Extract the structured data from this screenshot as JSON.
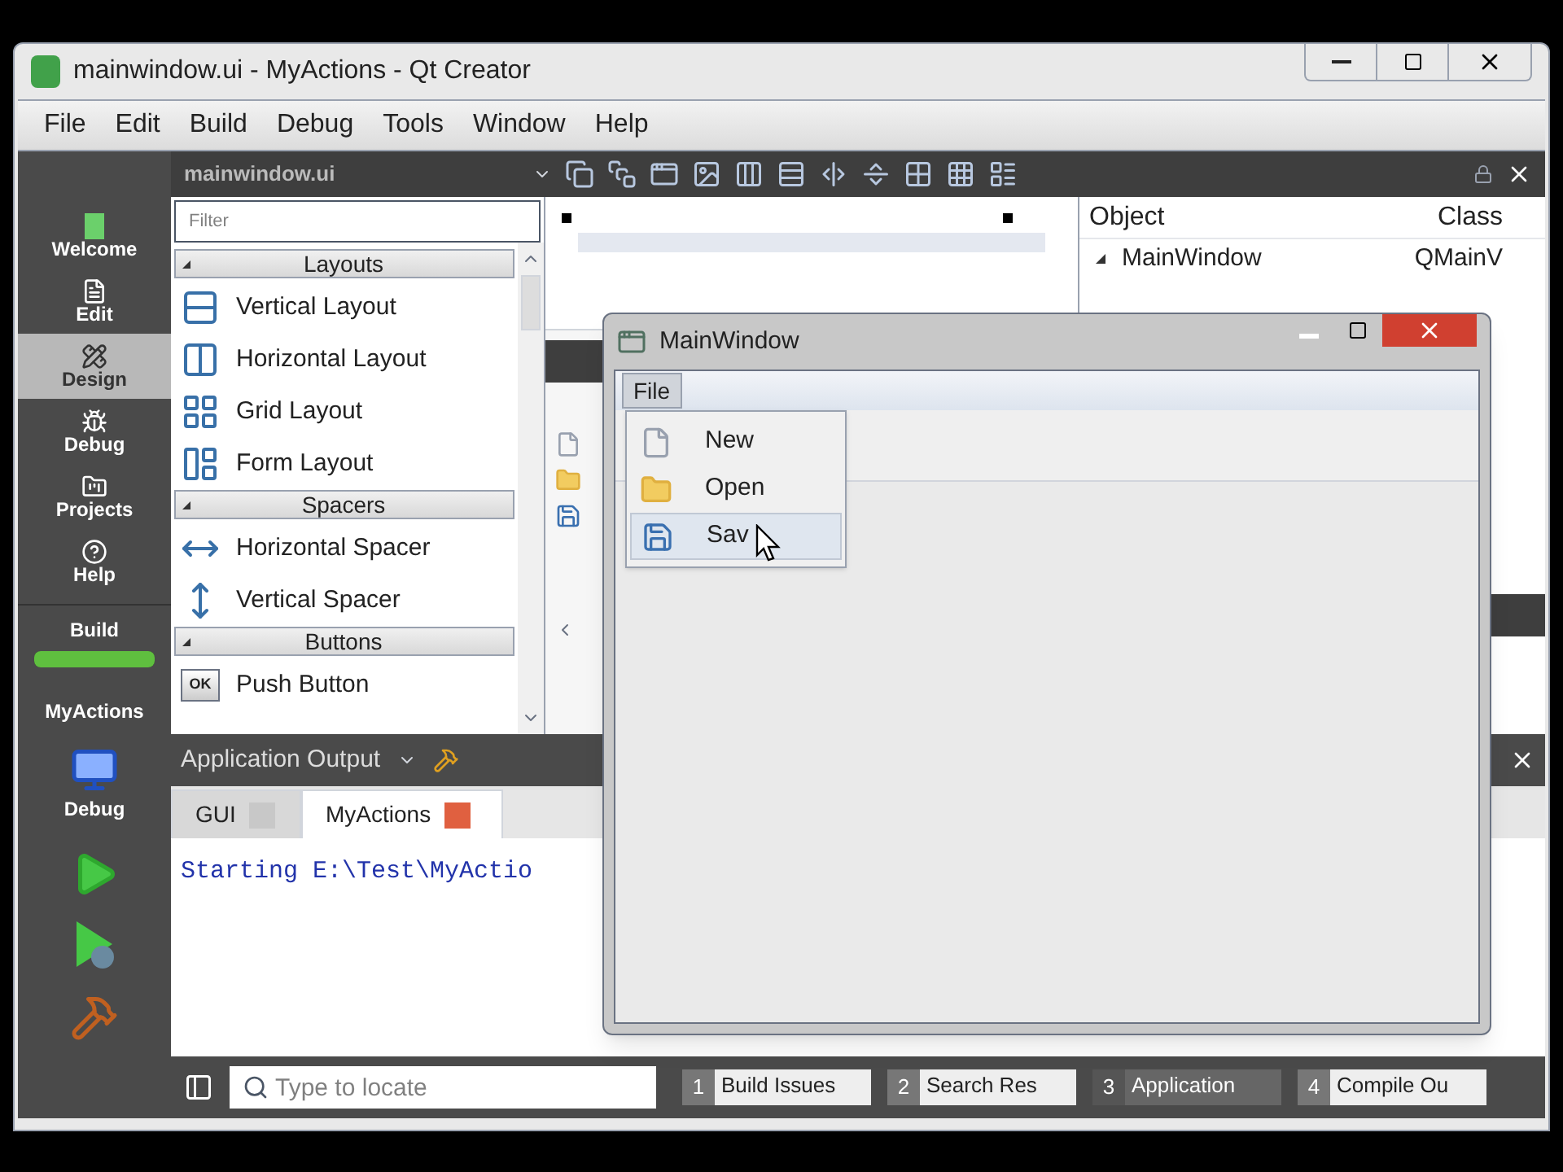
{
  "window": {
    "title": "mainwindow.ui - MyActions - Qt Creator"
  },
  "menu": [
    "File",
    "Edit",
    "Build",
    "Debug",
    "Tools",
    "Window",
    "Help"
  ],
  "modes": [
    {
      "label": "Welcome",
      "kind": "welcome",
      "selected": false
    },
    {
      "label": "Edit",
      "kind": "edit",
      "selected": false
    },
    {
      "label": "Design",
      "kind": "design",
      "selected": true
    },
    {
      "label": "Debug",
      "kind": "debug",
      "selected": false
    },
    {
      "label": "Projects",
      "kind": "projects",
      "selected": false
    },
    {
      "label": "Help",
      "kind": "help",
      "selected": false
    }
  ],
  "build": {
    "label": "Build",
    "level": 1
  },
  "project": {
    "name": "MyActions",
    "target": "Debug"
  },
  "editor": {
    "document": "mainwindow.ui"
  },
  "widget_box": {
    "filter_placeholder": "Filter",
    "categories": [
      {
        "name": "Layouts",
        "expanded": true,
        "items": [
          {
            "label": "Vertical Layout",
            "kind": "vlayout"
          },
          {
            "label": "Horizontal Layout",
            "kind": "hlayout"
          },
          {
            "label": "Grid Layout",
            "kind": "grid"
          },
          {
            "label": "Form Layout",
            "kind": "form"
          }
        ]
      },
      {
        "name": "Spacers",
        "expanded": true,
        "items": [
          {
            "label": "Horizontal Spacer",
            "kind": "hspacer"
          },
          {
            "label": "Vertical Spacer",
            "kind": "vspacer"
          }
        ]
      },
      {
        "name": "Buttons",
        "expanded": true,
        "items": [
          {
            "label": "Push Button",
            "kind": "push",
            "icon_label": "OK"
          }
        ]
      }
    ]
  },
  "object_inspector": {
    "columns": [
      "Object",
      "Class"
    ],
    "rows": [
      {
        "object": "MainWindow",
        "class": "QMainV",
        "expanded": true
      }
    ]
  },
  "output": {
    "title": "Application Output",
    "tabs": [
      {
        "label": "GUI",
        "selected": false
      },
      {
        "label": "MyActions",
        "selected": true
      }
    ],
    "text": "Starting E:\\Test\\MyActio"
  },
  "status_bar": {
    "locator_placeholder": "Type to locate",
    "panes": [
      {
        "number": "1",
        "label": "Build Issues",
        "selected": false
      },
      {
        "number": "2",
        "label": "Search Res",
        "selected": false
      },
      {
        "number": "3",
        "label": "Application",
        "selected": true
      },
      {
        "number": "4",
        "label": "Compile Ou",
        "selected": false
      }
    ]
  },
  "preview": {
    "title": "MainWindow",
    "menu": [
      {
        "label": "File",
        "selected": true
      }
    ],
    "menu_items": [
      {
        "label": "New",
        "kind": "new",
        "selected": false
      },
      {
        "label": "Open",
        "kind": "open",
        "selected": false
      },
      {
        "label": "Sav",
        "kind": "save",
        "selected": true
      }
    ]
  }
}
